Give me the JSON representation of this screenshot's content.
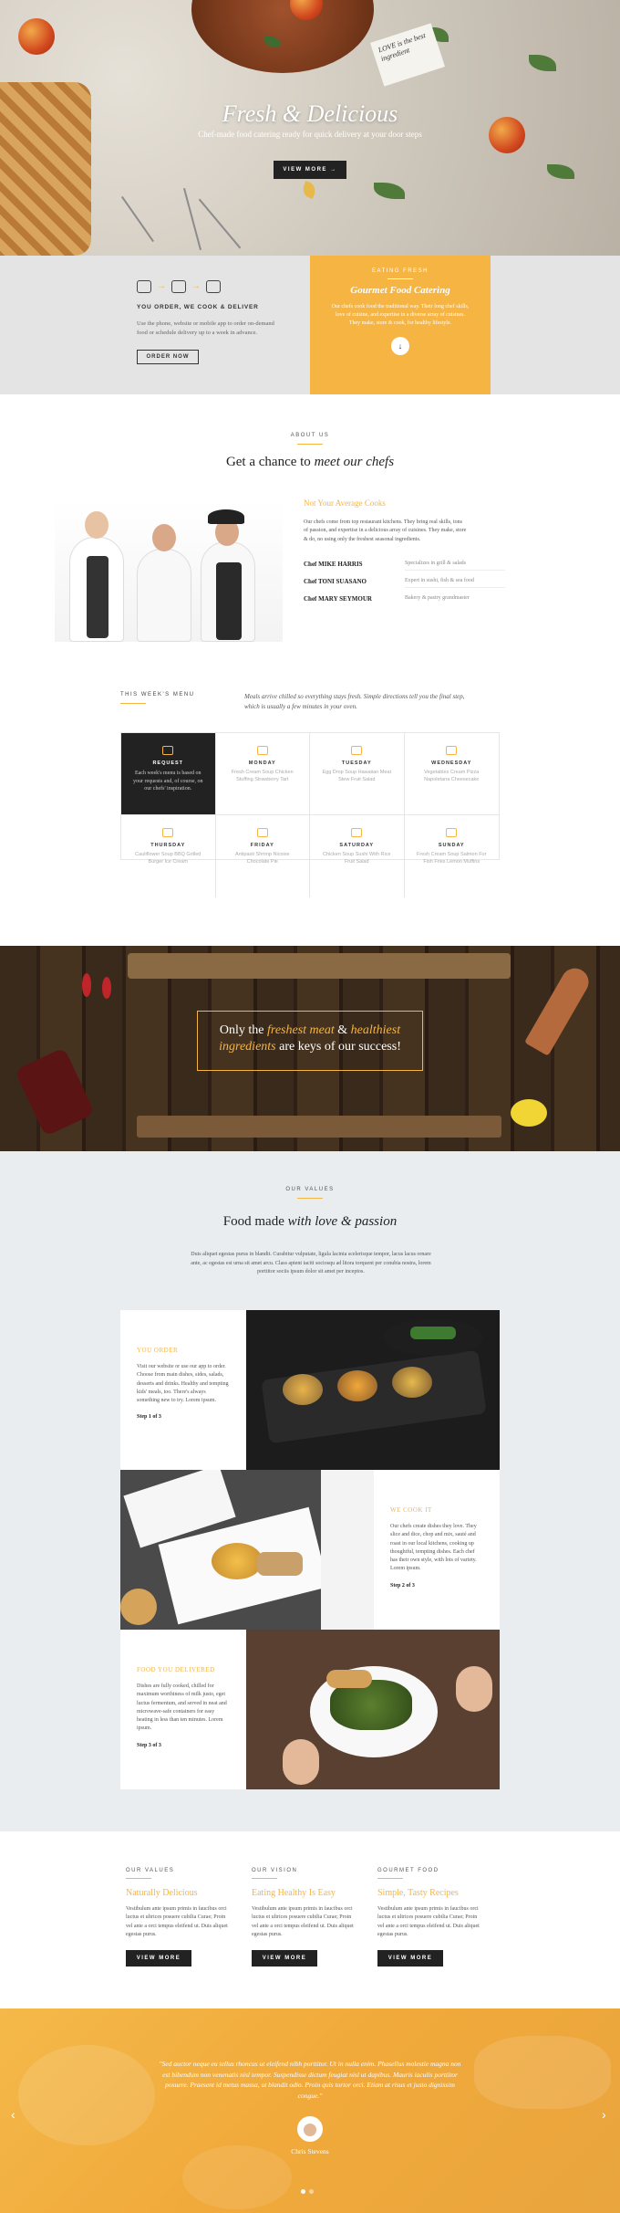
{
  "hero": {
    "title": "Fresh & Delicious",
    "subtitle": "Chef-made food catering ready for quick delivery at your door steps",
    "button": "VIEW MORE →",
    "card_text": "LOVE is the best ingredient"
  },
  "order": {
    "heading": "YOU ORDER, WE COOK & DELIVER",
    "text": "Use the phone, website or mobile app to order on-demand food or schedule delivery up to a week in advance.",
    "button": "ORDER NOW"
  },
  "catering": {
    "label": "EATING FRESH",
    "title": "Gourmet Food Catering",
    "text": "Our chefs cook food the traditional way. Their long chef skills, love of cuisine, and expertise in a diverse array of cuisines. They make, store & cook, for healthy lifestyle.",
    "icon": "chevron-down-icon"
  },
  "about": {
    "label": "ABOUT US",
    "title_plain": "Get a chance to ",
    "title_italic": "meet our chefs",
    "subtitle": "Not Your Average Cooks",
    "text": "Our chefs come from top restaurant kitchens. They bring real skills, tons of passion, and expertise in a delicious array of cuisines. They make, store & do, no using only the freshest seasonal ingredients.",
    "chefs": [
      {
        "name": "Chef MIKE HARRIS",
        "specialty": "Specializes in grill & salads"
      },
      {
        "name": "Chef TONI SUASANO",
        "specialty": "Expert in sushi, fish & sea food"
      },
      {
        "name": "Chef MARY SEYMOUR",
        "specialty": "Bakery & pastry grandmaster"
      }
    ]
  },
  "menu": {
    "label": "THIS WEEK'S MENU",
    "intro": "Meals arrive chilled so everything stays fresh. Simple directions tell you the final step, which is usually a few minutes in your oven.",
    "request": {
      "day": "REQUEST",
      "text": "Each week's menu is based on your requests and, of course, on our chefs' inspiration."
    },
    "days": [
      {
        "day": "MONDAY",
        "dish": "Fresh Cream Soup Chicken Stuffing Strawberry Tart"
      },
      {
        "day": "TUESDAY",
        "dish": "Egg Drop Soup Hawaiian Meat Stew Fruit Salad"
      },
      {
        "day": "WEDNESDAY",
        "dish": "Vegetables Cream Pizza Napoletana Cheesecake"
      },
      {
        "day": "THURSDAY",
        "dish": "Cauliflower Soup BBQ Grilled Burger Ice Cream"
      },
      {
        "day": "FRIDAY",
        "dish": "Antipasti Shrimp Nicoise Chocolate Pie"
      },
      {
        "day": "SATURDAY",
        "dish": "Chicken Soup Sushi With Rice Fruit Salad"
      },
      {
        "day": "SUNDAY",
        "dish": "Fresh Cream Soup Salmon For Fish Fries Lemon Muffins"
      }
    ]
  },
  "banner": {
    "line1_plain": "Only the ",
    "line1_italic": "freshest meat",
    "line1_amp": " & ",
    "line1_italic2": "healthiest",
    "line2_italic": "ingredients",
    "line2_plain": " are keys of our success!"
  },
  "values": {
    "label": "OUR VALUES",
    "title_plain": "Food made ",
    "title_italic": "with love & passion",
    "text": "Duis aliquet egestas purus in blandit. Curabitur vulputate, ligula lacinia scelerisque tempor, lacus lacus ornare ante, ac egestas est urna sit amet arcu. Class aptent taciti sociosqu ad litora torquent per conubia nostra, lorem porttitor sociis ipsum dolor sit amet per inceptos.",
    "steps": [
      {
        "title": "YOU ORDER",
        "text": "Visit our website or use our app to order. Choose from main dishes, sides, salads, desserts and drinks. Healthy and tempting kids' meals, too. There's always something new to try. Lorem ipsum.",
        "step": "Step 1 of 3"
      },
      {
        "title": "WE COOK IT",
        "text": "Our chefs create dishes they love. They slice and dice, chop and mix, sauté and roast in our local kitchens, cooking up thoughtful, tempting dishes. Each chef has their own style, with lots of variety. Lorem ipsum.",
        "step": "Step 2 of 3"
      },
      {
        "title": "FOOD YOU DELIVERED",
        "text": "Dishes are fully cooked, chilled for maximum worthiness of milk justo, eget luctus fermentum, and served in neat and microwave-safe containers for easy heating in less than ten minutes. Lorem ipsum.",
        "step": "Step 3 of 3"
      }
    ]
  },
  "columns": [
    {
      "label": "OUR VALUES",
      "title": "Naturally Delicious",
      "text": "Vestibulum ante ipsum primis in faucibus orci luctus et ultrices posuere cubilia Curae; Proin vel ante a orci tempus eleifend ut. Duis aliquet egestas purus.",
      "button": "VIEW MORE"
    },
    {
      "label": "OUR VISION",
      "title": "Eating Healthy Is Easy",
      "text": "Vestibulum ante ipsum primis in faucibus orci luctus et ultrices posuere cubilia Curae; Proin vel ante a orci tempus eleifend ut. Duis aliquet egestas purus.",
      "button": "VIEW MORE"
    },
    {
      "label": "GOURMET FOOD",
      "title": "Simple, Tasty Recipes",
      "text": "Vestibulum ante ipsum primis in faucibus orci luctus et ultrices posuere cubilia Curae; Proin vel ante a orci tempus eleifend ut. Duis aliquet egestas purus.",
      "button": "VIEW MORE"
    }
  ],
  "testimonial": {
    "quote": "\"Sed auctor neque eu tellus rhoncus ut eleifend nibh porttitor. Ut in nulla enim. Phasellus molestie magna non est bibendum non venenatis nisl tempor. Suspendisse dictum feugiat nisl ut dapibus. Mauris iaculis porttitor posuere. Praesent id metus massa, ut blandit odio. Proin quis tortor orci. Etiam at risus et justo dignissim congue.\"",
    "name": "Chris Stevens",
    "prev": "‹",
    "next": "›"
  },
  "colors": {
    "accent": "#f6b442",
    "dark": "#222222",
    "values_bg": "#e9edf0"
  }
}
